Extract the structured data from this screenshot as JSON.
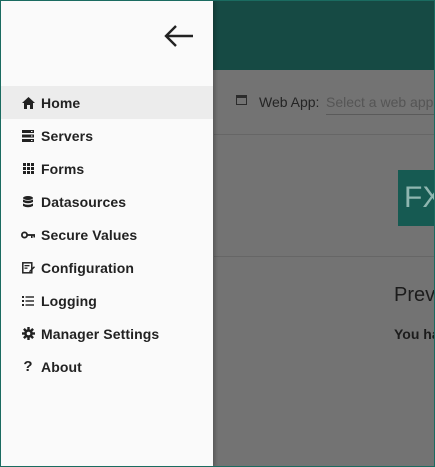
{
  "toolbar": {
    "web_app_label": "Web App:",
    "web_app_placeholder": "Select a web app"
  },
  "main": {
    "logo_text": "FX",
    "heading_fragment": "Prev",
    "text_fragment": "You ha"
  },
  "drawer": {
    "back_icon": "arrow-left-icon",
    "items": [
      {
        "label": "Home",
        "icon": "home-icon",
        "active": true
      },
      {
        "label": "Servers",
        "icon": "servers-icon"
      },
      {
        "label": "Forms",
        "icon": "grid-icon"
      },
      {
        "label": "Datasources",
        "icon": "database-icon"
      },
      {
        "label": "Secure Values",
        "icon": "key-icon"
      },
      {
        "label": "Configuration",
        "icon": "configuration-icon"
      },
      {
        "label": "Logging",
        "icon": "list-icon"
      },
      {
        "label": "Manager Settings",
        "icon": "gear-icon"
      },
      {
        "label": "About",
        "icon": "question-icon"
      }
    ]
  },
  "colors": {
    "header": "#164a44",
    "drawer_bg": "#fafafa",
    "active_item_bg": "#ececec",
    "overlay": "#737373"
  }
}
